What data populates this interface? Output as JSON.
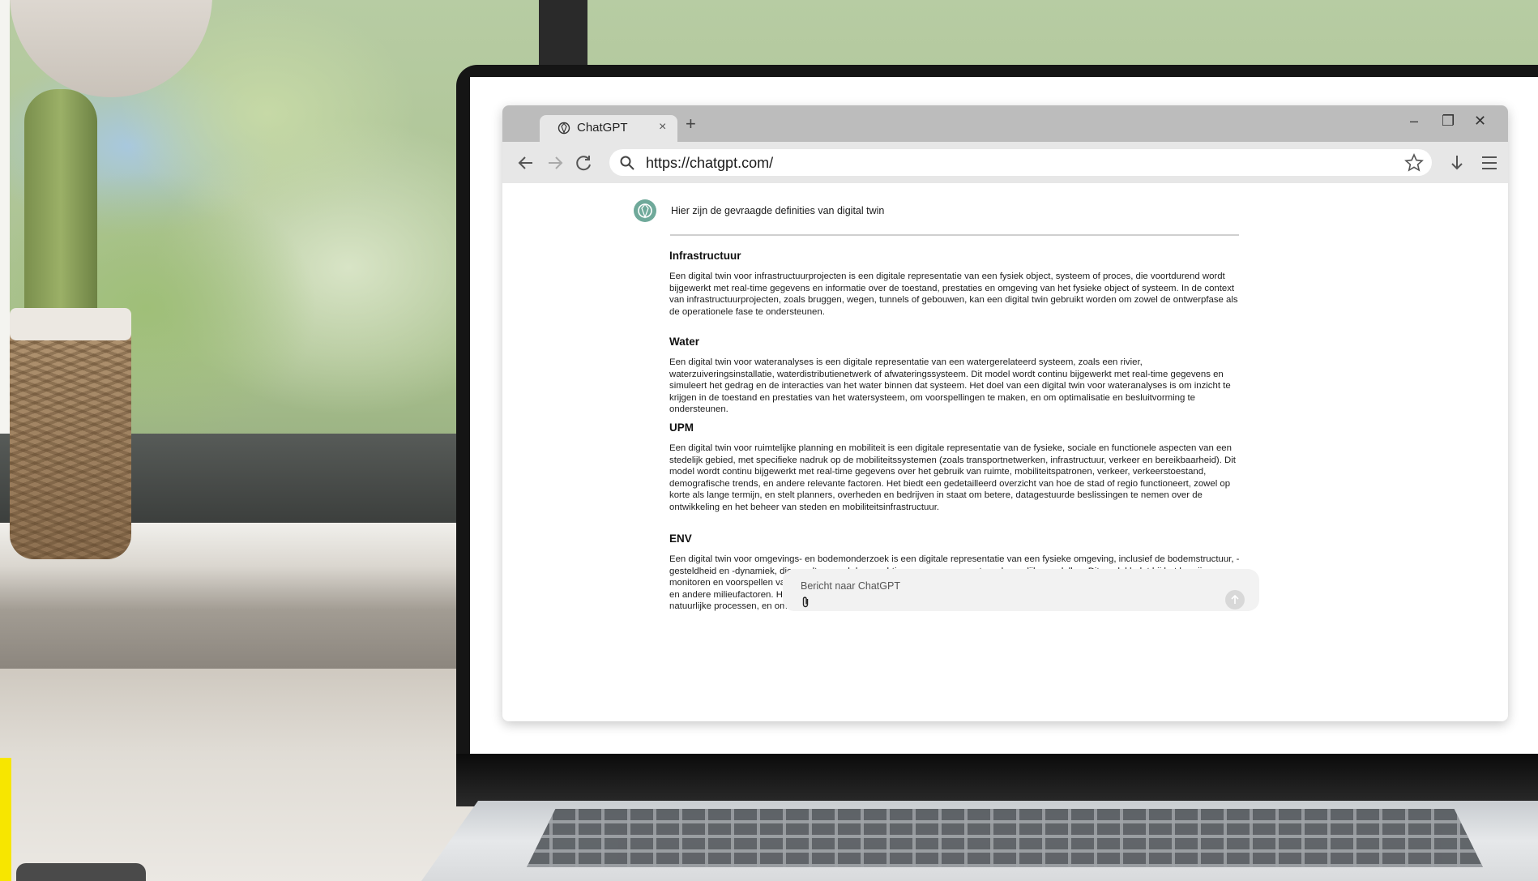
{
  "browser": {
    "tab_title": "ChatGPT",
    "tab_close": "×",
    "new_tab": "+",
    "url": "https://chatgpt.com/",
    "window_controls": {
      "minimize": "–",
      "restore": "❐",
      "close": "✕"
    },
    "icons": [
      "chatgpt-logo-icon",
      "back-arrow-icon",
      "forward-arrow-icon",
      "reload-icon",
      "search-icon",
      "star-icon",
      "download-icon",
      "menu-icon"
    ]
  },
  "chat": {
    "intro": "Hier zijn de gevraagde definities van digital twin",
    "sections": [
      {
        "heading": "Infrastructuur",
        "body": "Een digital twin voor infrastructuurprojecten is een digitale representatie van een fysiek object, systeem of proces, die voortdurend wordt bijgewerkt met real-time gegevens en informatie over de toestand, prestaties en omgeving van het fysieke object of systeem. In de context van infrastructuurprojecten, zoals bruggen, wegen, tunnels of gebouwen, kan een digital twin gebruikt worden om zowel de ontwerpfase als de operationele fase te ondersteunen."
      },
      {
        "heading": "Water",
        "body": "Een digital twin voor wateranalyses is een digitale representatie van een watergerelateerd systeem, zoals een rivier, waterzuiveringsinstallatie, waterdistributienetwerk of afwateringssysteem. Dit model wordt continu bijgewerkt met real-time gegevens en simuleert het gedrag en de interacties van het water binnen dat systeem. Het doel van een digital twin voor wateranalyses is om inzicht te krijgen in de toestand en prestaties van het watersysteem, om voorspellingen te maken, en om optimalisatie en besluitvorming te ondersteunen."
      },
      {
        "heading": "UPM",
        "body": "Een digital twin voor ruimtelijke planning en mobiliteit is een digitale representatie van de fysieke, sociale en functionele aspecten van een stedelijk gebied, met specifieke nadruk op de mobiliteitssystemen (zoals transportnetwerken, infrastructuur, verkeer en bereikbaarheid). Dit model wordt continu bijgewerkt met real-time gegevens over het gebruik van ruimte, mobiliteitspatronen, verkeer, verkeerstoestand, demografische trends, en andere relevante factoren. Het biedt een gedetailleerd overzicht van hoe de stad of regio functioneert, zowel op korte als lange termijn, en stelt planners, overheden en bedrijven in staat om betere, datagestuurde beslissingen te nemen over de ontwikkeling en het beheer van steden en mobiliteitsinfrastructuur."
      },
      {
        "heading": "ENV",
        "body": "Een digital twin voor omgevings- en bodemonderzoek is een digitale representatie van een fysieke omgeving, inclusief de bodemstructuur, -gesteldheid en -dynamiek, die wordt gevoed door real-time gegevens en wetenschappelijke modellen. Dit model helpt bij het begrijpen, monitoren en voorspellen van veranderingen in de bodem en de bredere omgeving, zoals verontreiniging, bodemdegradatie, waterstromen, en andere milieufactoren. Het doel is om betere inzichten te verkrijgen in de staat van de omgeving, de impact van menselijke activiteiten en natuurlijke processen, en om duurzamere en effectievere besluitvorming te ondersteunen."
      }
    ],
    "composer_placeholder": "Bericht naar ChatGPT"
  },
  "colors": {
    "tabbar": "#bcbcbc",
    "toolbar": "#e7e7e7",
    "avatar": "#6fa99a",
    "accent_yellow": "#f7e600"
  }
}
